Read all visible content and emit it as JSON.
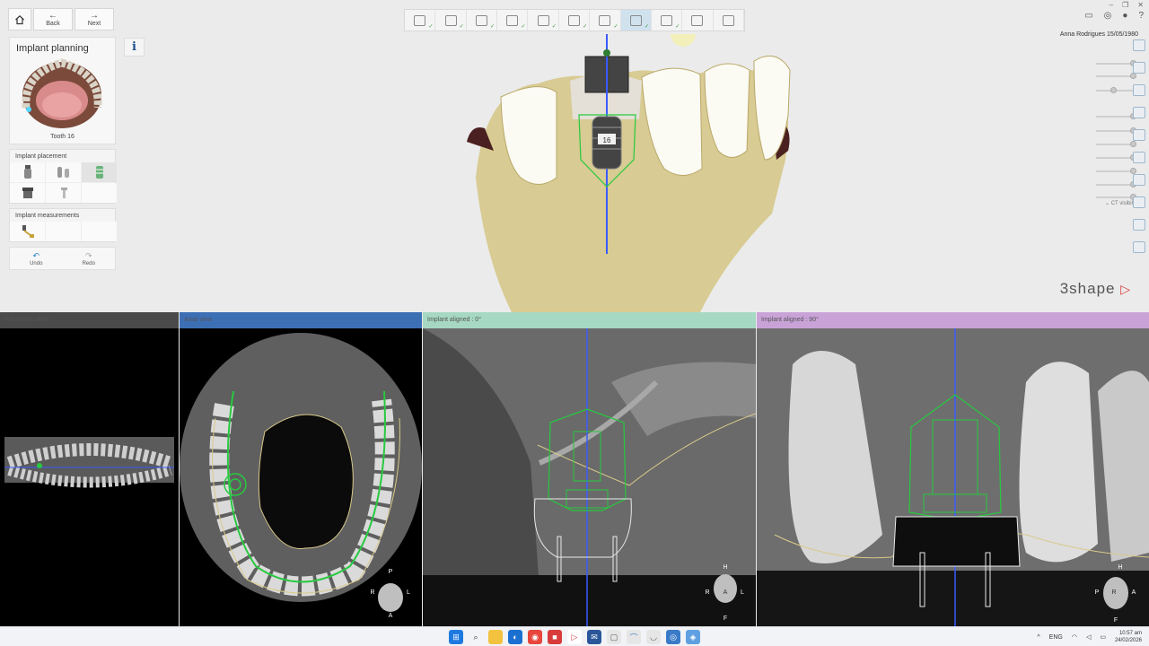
{
  "window": {
    "minimize": "–",
    "restore": "❐",
    "close": "✕"
  },
  "nav": {
    "home_icon": "home-icon",
    "back_label": "Back",
    "next_label": "Next"
  },
  "left_panel": {
    "title": "Implant planning",
    "tooth_caption": "Tooth 16",
    "placement_title": "Implant placement",
    "measurements_title": "Implant measurements",
    "undo_label": "Undo",
    "redo_label": "Redo"
  },
  "info_label": "i",
  "workflow_steps": [
    {
      "name": "order-form",
      "done": true,
      "active": false
    },
    {
      "name": "scan-import",
      "done": true,
      "active": false
    },
    {
      "name": "segmentation",
      "done": true,
      "active": false
    },
    {
      "name": "model-alignment",
      "done": true,
      "active": false
    },
    {
      "name": "tooth-design",
      "done": true,
      "active": false
    },
    {
      "name": "nerve-marking",
      "done": true,
      "active": false
    },
    {
      "name": "crown-setup",
      "done": true,
      "active": false
    },
    {
      "name": "implant-planning",
      "done": true,
      "active": true
    },
    {
      "name": "guide-design",
      "done": true,
      "active": false
    },
    {
      "name": "sleeve-setup",
      "done": false,
      "active": false
    },
    {
      "name": "export",
      "done": false,
      "active": false
    }
  ],
  "implant_label": "16",
  "patient": "Anna Rodrigues 15/05/1980",
  "ct_visibility": "CT visibility",
  "brand": "3shape",
  "views": {
    "panoramic": "Panoramic view",
    "axial": "Axial view",
    "aligned0": "Implant aligned : 0°",
    "aligned90": "Implant aligned : 90°"
  },
  "orientation": {
    "axial": {
      "top": "P",
      "left": "R",
      "right": "L",
      "bottom": "A"
    },
    "aligned0": {
      "top": "H",
      "left": "R",
      "right": "L",
      "bottom": "F",
      "center": "A"
    },
    "aligned90": {
      "top": "H",
      "left": "P",
      "right": "A",
      "bottom": "F",
      "center": "R"
    }
  },
  "taskbar": {
    "language": "ENG",
    "time": "10:57 am",
    "date": "24/02/2026"
  },
  "colors": {
    "panoramic_header": "#4a4a4a",
    "axial_header": "#3d6fb5",
    "aligned0_header": "#a6d8c4",
    "aligned90_header": "#c9a3d8",
    "implant_green": "#27c93f",
    "guide_line": "#3b5bff",
    "bone": "#d8c98a"
  }
}
